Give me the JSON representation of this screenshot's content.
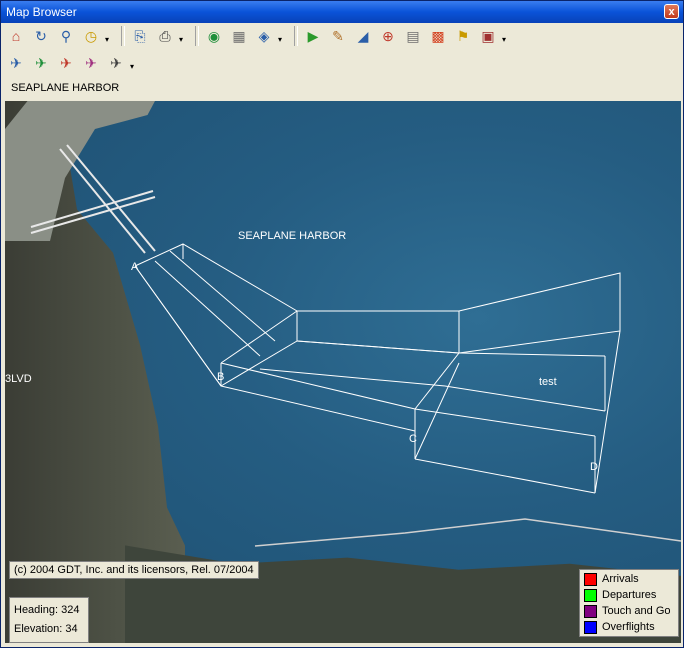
{
  "window": {
    "title": "Map Browser",
    "close_glyph": "x"
  },
  "location_name": "SEAPLANE HARBOR",
  "toolbar_row1": [
    {
      "name": "home-icon",
      "glyph": "⌂",
      "color": "#c0392b"
    },
    {
      "name": "refresh-map-icon",
      "glyph": "↻",
      "color": "#2a5ea8"
    },
    {
      "name": "zoom-icon",
      "glyph": "⚲",
      "color": "#2a5ea8"
    },
    {
      "name": "clock-icon",
      "glyph": "◷",
      "color": "#c99a00"
    },
    {
      "name": "copy-icon",
      "glyph": "⎘",
      "color": "#2a5ea8"
    },
    {
      "name": "print-icon",
      "glyph": "⎙",
      "color": "#404040"
    },
    {
      "name": "globe-icon",
      "glyph": "◉",
      "color": "#1f8f3a"
    },
    {
      "name": "grid-icon",
      "glyph": "▦",
      "color": "#707070"
    },
    {
      "name": "layers-icon",
      "glyph": "◈",
      "color": "#2a5ea8"
    },
    {
      "name": "play-icon",
      "glyph": "▶",
      "color": "#2b9a2b"
    },
    {
      "name": "edit-icon",
      "glyph": "✎",
      "color": "#b0712a"
    },
    {
      "name": "measure-icon",
      "glyph": "◢",
      "color": "#2a5ea8"
    },
    {
      "name": "compass-icon",
      "glyph": "⊕",
      "color": "#c0392b"
    },
    {
      "name": "document-icon",
      "glyph": "▤",
      "color": "#707070"
    },
    {
      "name": "palette-icon",
      "glyph": "▩",
      "color": "#d4401f"
    },
    {
      "name": "3d-icon",
      "glyph": "⚑",
      "color": "#c99a00"
    },
    {
      "name": "settings-icon",
      "glyph": "▣",
      "color": "#a03030"
    }
  ],
  "toolbar_row2": [
    {
      "name": "flight-track-icon",
      "glyph": "✈",
      "color": "#2a5ea8"
    },
    {
      "name": "flight-path-icon",
      "glyph": "✈",
      "color": "#1f8f3a"
    },
    {
      "name": "flight-multi-icon",
      "glyph": "✈",
      "color": "#c0392b"
    },
    {
      "name": "flight-tag-icon",
      "glyph": "✈",
      "color": "#a03080"
    },
    {
      "name": "flight-filter-icon",
      "glyph": "✈",
      "color": "#404040"
    }
  ],
  "map": {
    "labels": {
      "harbor": "SEAPLANE HARBOR",
      "test": "test",
      "blvd": "3LVD",
      "A": "A",
      "B": "B",
      "C": "C",
      "D": "D"
    },
    "copyright": "(c) 2004 GDT, Inc. and its licensors, Rel. 07/2004",
    "heading_label": "Heading:",
    "heading_value": "324",
    "elevation_label": "Elevation:",
    "elevation_value": "34"
  },
  "legend": [
    {
      "label": "Arrivals",
      "color": "#ff0000"
    },
    {
      "label": "Departures",
      "color": "#00ff00"
    },
    {
      "label": "Touch and Go",
      "color": "#800080"
    },
    {
      "label": "Overflights",
      "color": "#0000ff"
    }
  ]
}
